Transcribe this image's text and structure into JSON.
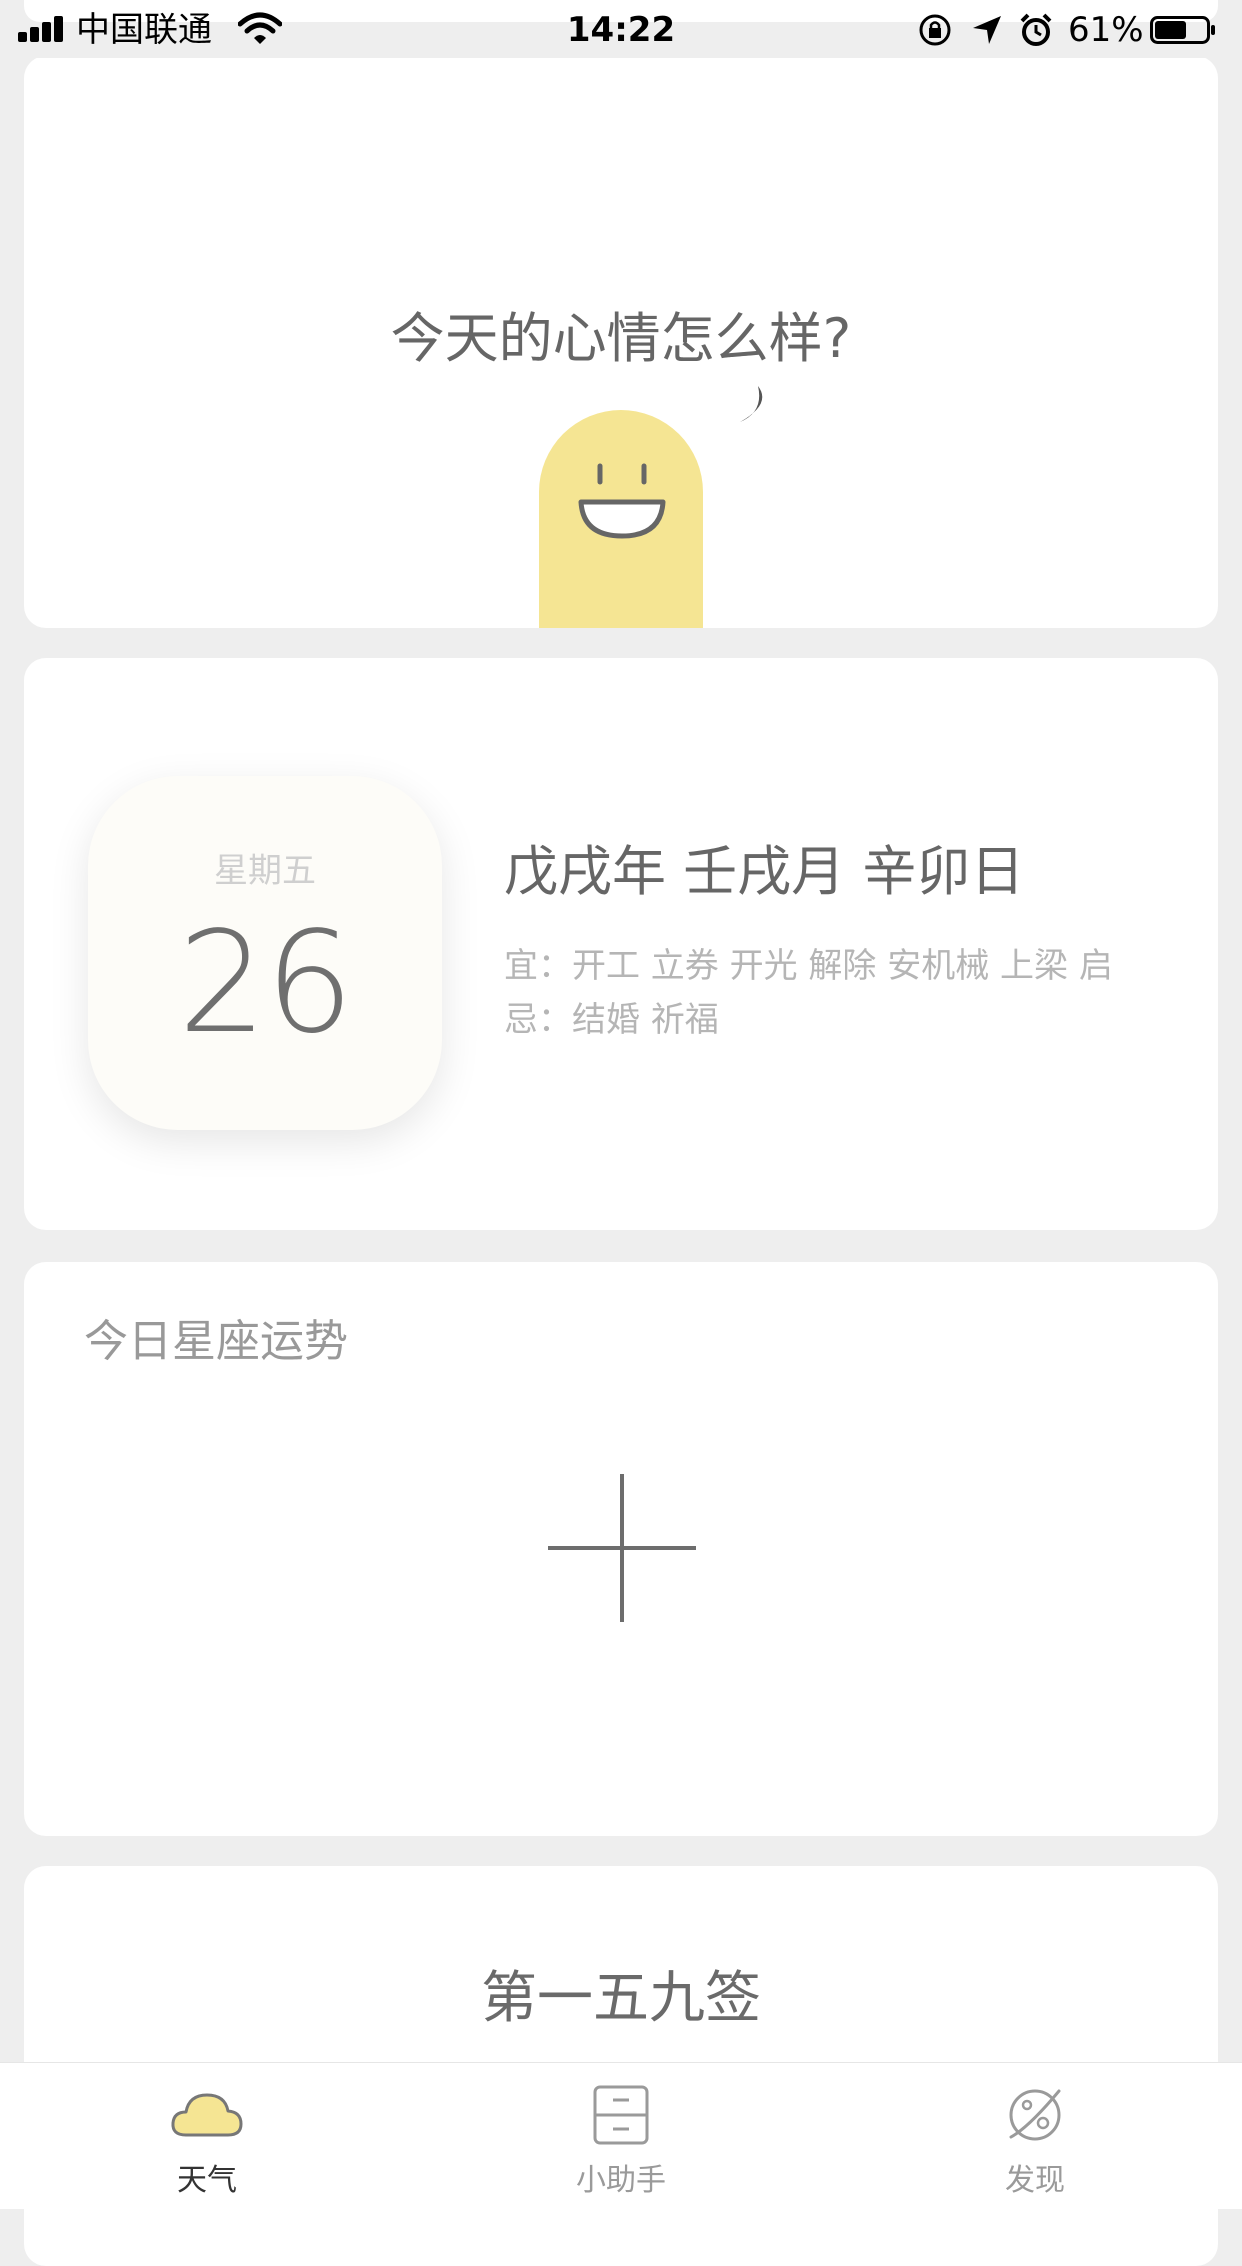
{
  "status_bar": {
    "carrier": "中国联通",
    "time": "14:22",
    "battery_percent": "61%",
    "battery_level": 0.61
  },
  "mood_card": {
    "question": "今天的心情怎么样?",
    "mascot_color": "#f5e593"
  },
  "almanac_card": {
    "weekday": "星期五",
    "day": "26",
    "ganzhi": "戊戌年 壬戌月 辛卯日",
    "yi": "宜：开工 立券 开光 解除 安机械 上梁 启",
    "ji": "忌：结婚 祈福"
  },
  "horoscope_card": {
    "title": "今日星座运势"
  },
  "lottery_card": {
    "title": "第一五九签"
  },
  "tab_bar": {
    "tabs": [
      {
        "label": "天气",
        "icon": "cloud-icon",
        "active": true
      },
      {
        "label": "小助手",
        "icon": "drawer-icon",
        "active": false
      },
      {
        "label": "发现",
        "icon": "planet-icon",
        "active": false
      }
    ],
    "active_color": "#f5e593"
  }
}
